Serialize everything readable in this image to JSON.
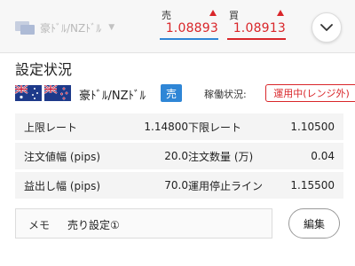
{
  "header": {
    "pair_select": {
      "label": "豪ﾄﾞﾙ/NZﾄﾞﾙ",
      "icon": "chevron-down-icon"
    },
    "sell": {
      "label": "売",
      "price": "1.08893",
      "direction_icon": "up-triangle-icon",
      "color": "#d9262a"
    },
    "buy": {
      "label": "買",
      "price": "1.08913",
      "direction_icon": "up-triangle-icon",
      "color": "#d9262a"
    },
    "expand_button_icon": "chevron-down-icon"
  },
  "section": {
    "title": "設定状況",
    "pair_name": "豪ﾄﾞﾙ/NZﾄﾞﾙ",
    "side": "売",
    "side_color": "#2f86d6",
    "status_label": "稼働状況:",
    "status": "運用中(レンジ外)",
    "status_color": "#d9262a"
  },
  "details": [
    {
      "label_l": "上限レート",
      "value_l": "1.14800",
      "label_r": "下限レート",
      "value_r": "1.10500"
    },
    {
      "label_l": "注文値幅 (pips)",
      "value_l": "20.0",
      "label_r": "注文数量 (万)",
      "value_r": "0.04"
    },
    {
      "label_l": "益出し幅 (pips)",
      "value_l": "70.0",
      "label_r": "運用停止ライン",
      "value_r": "1.15500"
    }
  ],
  "memo": {
    "label": "メモ",
    "value": "売り設定①"
  },
  "edit_button": {
    "label": "編集"
  }
}
